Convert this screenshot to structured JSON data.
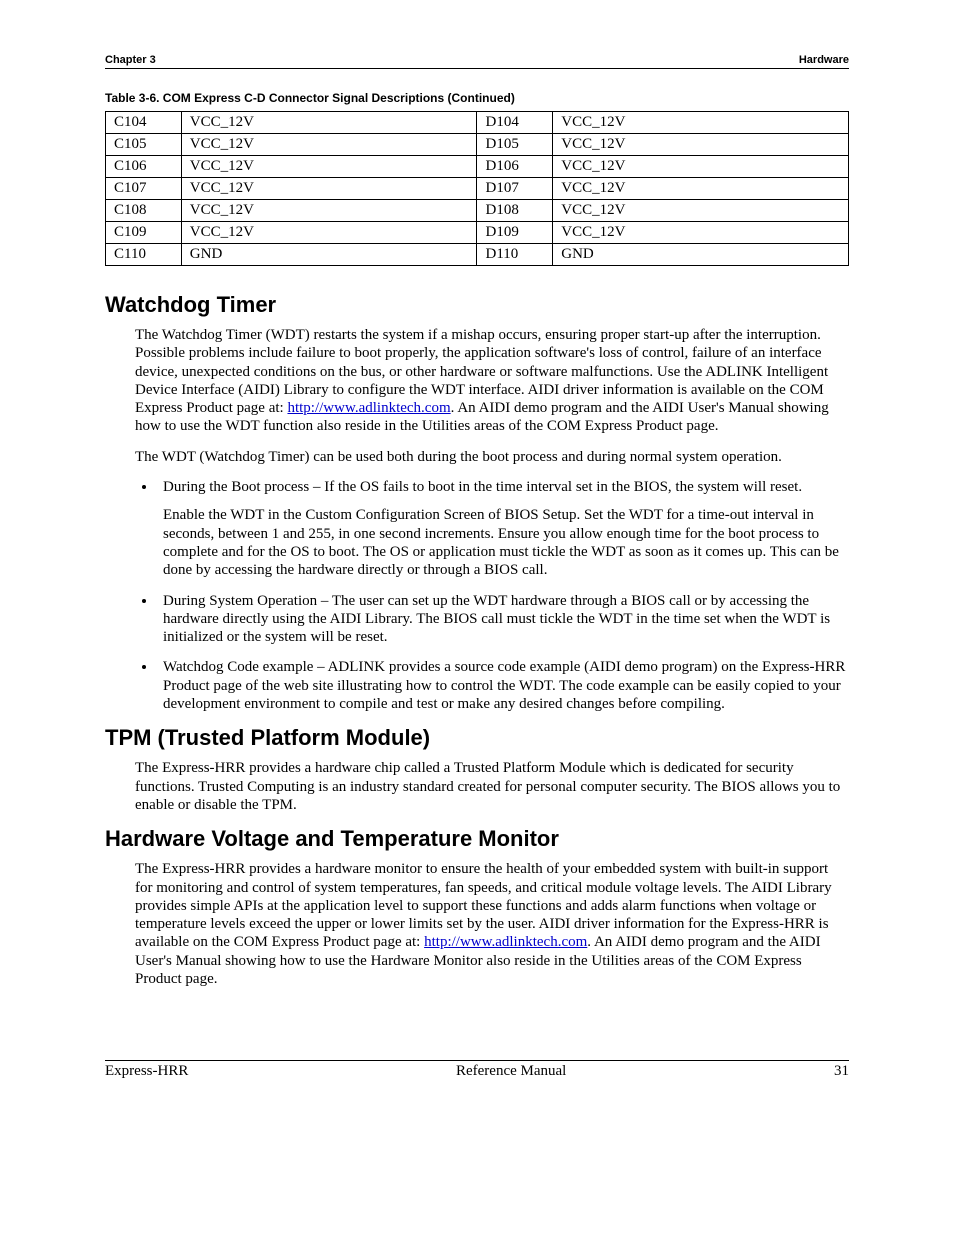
{
  "header": {
    "left": "Chapter 3",
    "right": "Hardware"
  },
  "table": {
    "caption": "Table 3-6.   COM Express C-D Connector Signal Descriptions (Continued)",
    "rows": [
      {
        "c_pin": "C104",
        "c_sig": "VCC_12V",
        "d_pin": "D104",
        "d_sig": "VCC_12V"
      },
      {
        "c_pin": "C105",
        "c_sig": "VCC_12V",
        "d_pin": "D105",
        "d_sig": "VCC_12V"
      },
      {
        "c_pin": "C106",
        "c_sig": "VCC_12V",
        "d_pin": "D106",
        "d_sig": "VCC_12V"
      },
      {
        "c_pin": "C107",
        "c_sig": "VCC_12V",
        "d_pin": "D107",
        "d_sig": "VCC_12V"
      },
      {
        "c_pin": "C108",
        "c_sig": "VCC_12V",
        "d_pin": "D108",
        "d_sig": "VCC_12V"
      },
      {
        "c_pin": "C109",
        "c_sig": "VCC_12V",
        "d_pin": "D109",
        "d_sig": "VCC_12V"
      },
      {
        "c_pin": "C110",
        "c_sig": "GND",
        "d_pin": "D110",
        "d_sig": "GND"
      }
    ]
  },
  "sections": {
    "wdt": {
      "title": "Watchdog Timer",
      "p1a": "The Watchdog Timer (WDT) restarts the system if a mishap occurs, ensuring proper start-up after the interruption. Possible problems include failure to boot properly, the application software's loss of control, failure of an interface device, unexpected conditions on the bus, or other hardware or software malfunctions. Use the ADLINK Intelligent Device Interface (AIDI) Library to configure the WDT interface. AIDI driver information is available on the COM Express Product page at: ",
      "p1link": "http://www.adlinktech.com",
      "p1b": ". An AIDI demo program and the AIDI User's Manual showing how to use the WDT function also reside in the Utilities areas of the COM Express Product page.",
      "p2": "The WDT (Watchdog Timer) can be used both during the boot process and during normal system operation.",
      "b1": "During the Boot process – If the OS fails to boot in the time interval set in the BIOS, the system will reset.",
      "b1p": "Enable the WDT in the Custom Configuration Screen of BIOS Setup. Set the WDT for a time-out interval in seconds, between 1 and 255, in one second increments. Ensure you allow enough time for the boot process to complete and for the OS to boot. The OS or application must tickle the WDT as soon as it comes up. This can be done by accessing the hardware directly or through a BIOS call.",
      "b2": "During System Operation – The user can set up the WDT hardware through a BIOS call or by accessing the hardware directly using the AIDI Library. The BIOS call must tickle the WDT in the time set when the WDT is initialized or the system will be reset.",
      "b3": "Watchdog Code example – ADLINK provides a source code example (AIDI demo program) on the Express-HRR Product page of the web site illustrating how to control the WDT. The code example can be easily copied to your development environment to compile and test or make any desired changes before compiling."
    },
    "tpm": {
      "title": "TPM (Trusted Platform Module)",
      "p1": "The Express-HRR provides a hardware chip called a Trusted Platform Module which is dedicated for security functions. Trusted Computing is an industry standard created for personal computer security. The BIOS allows you to enable or disable the TPM."
    },
    "hvt": {
      "title": "Hardware Voltage and Temperature Monitor",
      "p1a": "The Express-HRR provides a hardware monitor to ensure the health of your embedded system with built-in support for monitoring and control of system temperatures, fan speeds, and critical module voltage levels. The AIDI Library provides simple APIs at the application level to support these functions and adds alarm functions when voltage or temperature levels exceed the upper or lower limits set by the user. AIDI driver information for the Express-HRR is available on the COM Express Product page at: ",
      "p1link": "http://www.adlinktech.com",
      "p1b": ". An AIDI demo program and the AIDI User's Manual showing how to use the Hardware Monitor also reside in the Utilities areas of the COM Express Product page."
    }
  },
  "footer": {
    "left": "Express-HRR",
    "center": "Reference Manual",
    "right": "31"
  }
}
